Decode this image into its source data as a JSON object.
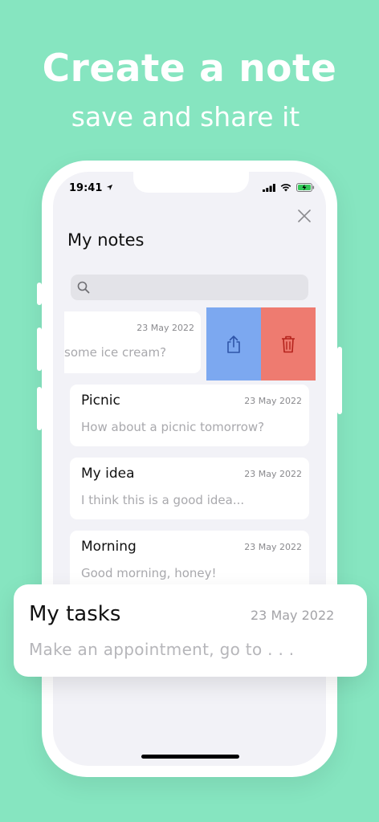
{
  "hero": {
    "title": "Create a note",
    "subtitle": "save and share it"
  },
  "status_bar": {
    "time": "19:41",
    "location_icon": "location-arrow-icon",
    "signal_icon": "cellular-signal-icon",
    "wifi_icon": "wifi-icon",
    "battery_icon": "battery-charging-icon"
  },
  "screen": {
    "title": "My notes",
    "close_icon": "close-icon",
    "search_icon": "search-icon",
    "search_placeholder": ""
  },
  "swiped_note": {
    "date": "23 May 2022",
    "body": "some ice cream?",
    "share_icon": "share-icon",
    "delete_icon": "trash-icon",
    "share_color": "#7ca8f0",
    "delete_color": "#ee7b70"
  },
  "notes": [
    {
      "title": "Picnic",
      "date": "23 May 2022",
      "body": "How about a picnic tomorrow?"
    },
    {
      "title": "My idea",
      "date": "23 May 2022",
      "body": "I think this is a good idea..."
    },
    {
      "title": "Morning",
      "date": "23 May 2022",
      "body": "Good morning, honey!"
    }
  ],
  "featured_note": {
    "title": "My tasks",
    "date": "23 May 2022",
    "body": "Make an appointment, go to . . ."
  },
  "colors": {
    "background": "#86e5c0",
    "screen": "#f2f2f7",
    "card": "#ffffff"
  }
}
